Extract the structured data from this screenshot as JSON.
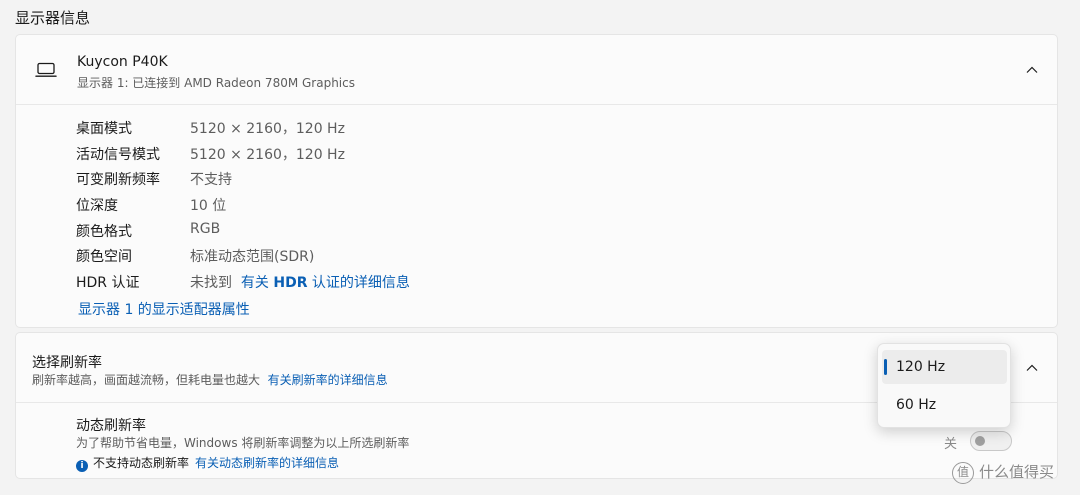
{
  "section_title": "显示器信息",
  "monitor": {
    "name": "Kuycon P40K",
    "subtitle": "显示器 1: 已连接到 AMD Radeon 780M Graphics",
    "icon": "laptop-icon",
    "rows": [
      {
        "key": "桌面模式",
        "value": "5120 × 2160，120 Hz"
      },
      {
        "key": "活动信号模式",
        "value": "5120 × 2160，120 Hz"
      },
      {
        "key": "可变刷新频率",
        "value": "不支持"
      },
      {
        "key": "位深度",
        "value": "10 位"
      },
      {
        "key": "颜色格式",
        "value": "RGB"
      },
      {
        "key": "颜色空间",
        "value": "标准动态范围(SDR)"
      }
    ],
    "hdr": {
      "key": "HDR 认证",
      "value": "未找到",
      "link_prefix": "有关 ",
      "link_bold": "HDR",
      "link_suffix": " 认证的详细信息"
    },
    "adapter_link": "显示器 1 的显示适配器属性"
  },
  "refresh": {
    "title": "选择刷新率",
    "subtitle": "刷新率越高，画面越流畅，但耗电量也越大",
    "subtitle_link": "有关刷新率的详细信息",
    "options": [
      "120 Hz",
      "60 Hz"
    ],
    "selected": "120 Hz"
  },
  "dynamic": {
    "title": "动态刷新率",
    "subtitle": "为了帮助节省电量，Windows 将刷新率调整为以上所选刷新率",
    "warning": "不支持动态刷新率",
    "link": "有关动态刷新率的详细信息",
    "toggle_label": "关",
    "toggle_on": false
  },
  "watermark": {
    "icon_text": "值",
    "text": "什么值得买"
  },
  "colors": {
    "accent": "#0a5fb4",
    "background": "#f3f3f3",
    "card": "#fbfbfb"
  }
}
